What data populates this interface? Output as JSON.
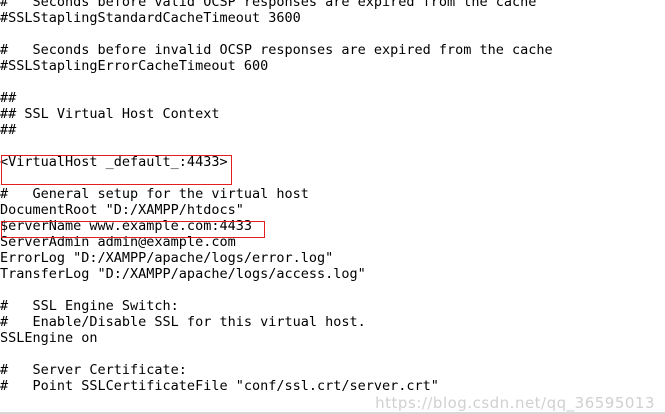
{
  "editor": {
    "lines": [
      "#   Seconds before valid OCSP responses are expired from the cache",
      "#SSLStaplingStandardCacheTimeout 3600",
      "",
      "#   Seconds before invalid OCSP responses are expired from the cache",
      "#SSLStaplingErrorCacheTimeout 600",
      "",
      "##",
      "## SSL Virtual Host Context",
      "##",
      "",
      "<VirtualHost _default_:4433>",
      "",
      "#   General setup for the virtual host",
      "DocumentRoot \"D:/XAMPP/htdocs\"",
      "$erverName www.example.com:4433",
      "ServerAdmin admin@example.com",
      "ErrorLog \"D:/XAMPP/apache/logs/error.log\"",
      "TransferLog \"D:/XAMPP/apache/logs/access.log\"",
      "",
      "#   SSL Engine Switch:",
      "#   Enable/Disable SSL for this virtual host.",
      "SSLEngine on",
      "",
      "#   Server Certificate:",
      "#   Point SSLCertificateFile \"conf/ssl.crt/server.crt\""
    ]
  },
  "highlight_color": "#e02020",
  "watermark": "https://blog.csdn.net/qq_36595013"
}
